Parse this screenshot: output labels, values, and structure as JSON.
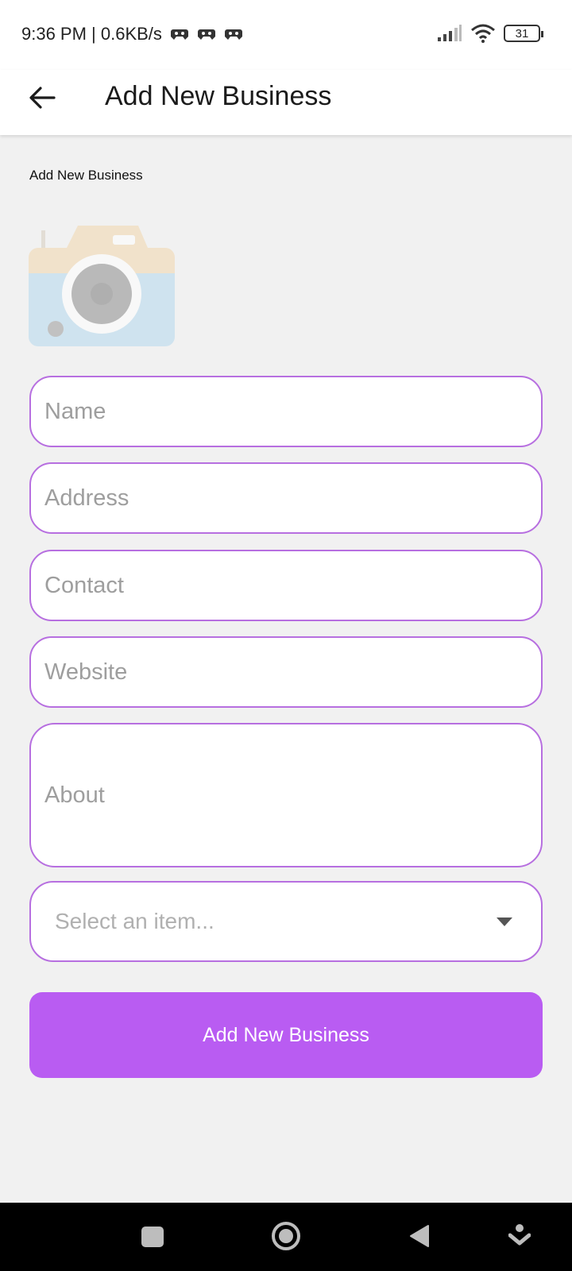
{
  "status_bar": {
    "time_speed": "9:36 PM | 0.6KB/s",
    "battery": "31",
    "icons": [
      "game-controller-icon",
      "game-controller-icon",
      "game-controller-icon",
      "signal-icon",
      "wifi-icon",
      "battery-icon"
    ]
  },
  "app_bar": {
    "back_icon": "back-arrow-icon",
    "title": "Add New Business"
  },
  "form": {
    "section_label": "Add New Business",
    "image_picker_icon": "camera-icon",
    "name_placeholder": "Name",
    "address_placeholder": "Address",
    "contact_placeholder": "Contact",
    "website_placeholder": "Website",
    "about_placeholder": "About",
    "dropdown_placeholder": "Select an item...",
    "submit_label": "Add New Business"
  },
  "colors": {
    "accent": "#b95cf2",
    "field_border": "#b76fe0",
    "background": "#f1f1f1"
  },
  "nav_bar": {
    "icons": [
      "recents-icon",
      "home-icon",
      "back-icon",
      "assist-icon"
    ]
  }
}
